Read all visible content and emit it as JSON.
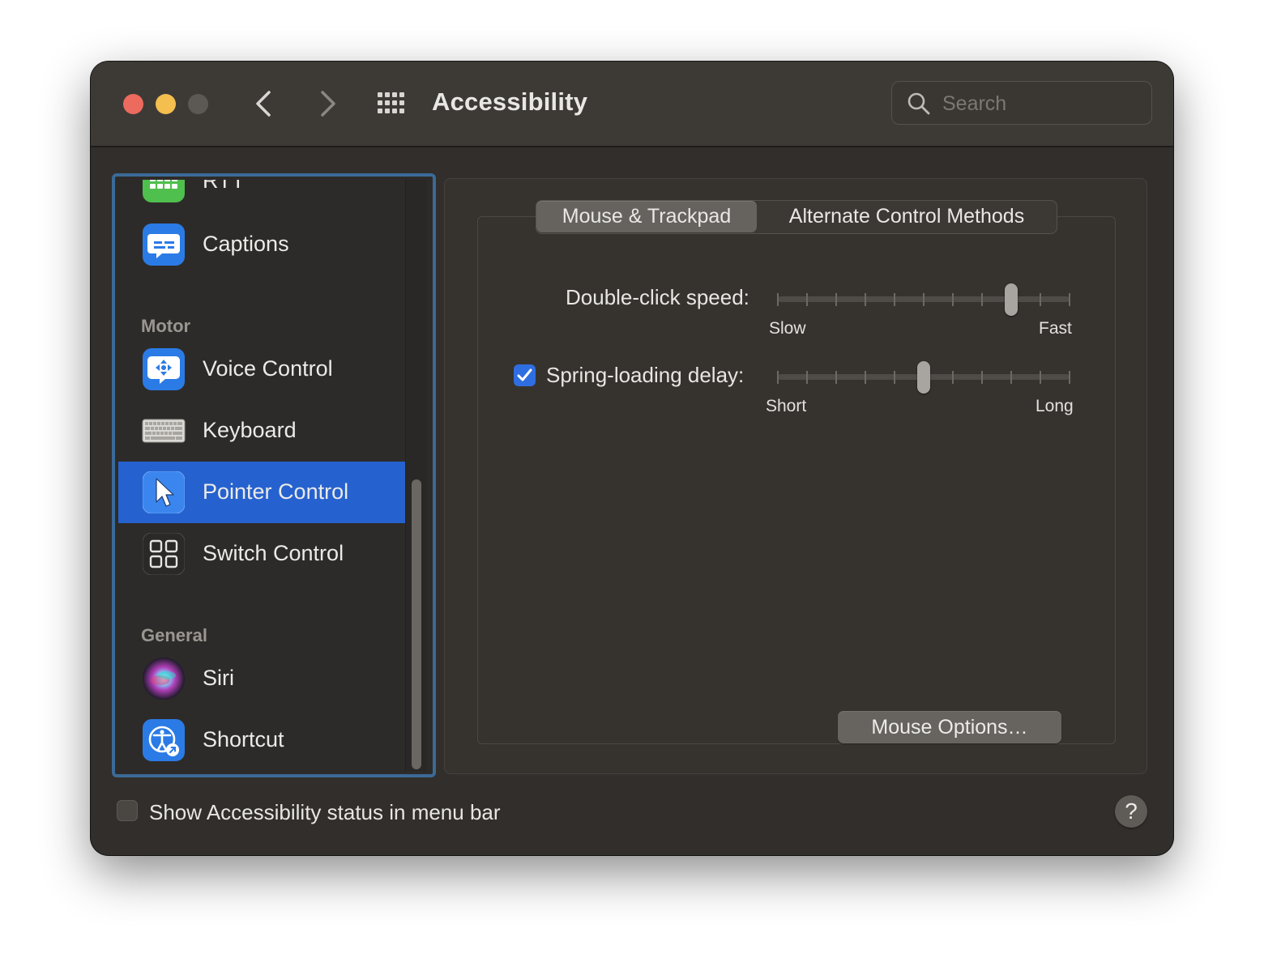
{
  "window": {
    "title": "Accessibility"
  },
  "search": {
    "placeholder": "Search"
  },
  "sidebar": {
    "items": [
      {
        "label": "RTT",
        "icon": "rtt-icon"
      },
      {
        "label": "Captions",
        "icon": "captions-icon"
      },
      {
        "label": "Voice Control",
        "icon": "voice-control-icon"
      },
      {
        "label": "Keyboard",
        "icon": "keyboard-icon"
      },
      {
        "label": "Pointer Control",
        "icon": "pointer-control-icon",
        "selected": true
      },
      {
        "label": "Switch Control",
        "icon": "switch-control-icon"
      },
      {
        "label": "Siri",
        "icon": "siri-icon"
      },
      {
        "label": "Shortcut",
        "icon": "shortcut-icon"
      }
    ],
    "sections": {
      "motor": "Motor",
      "general": "General"
    }
  },
  "tabs": [
    {
      "label": "Mouse & Trackpad",
      "active": true
    },
    {
      "label": "Alternate Control Methods",
      "active": false
    }
  ],
  "settings": {
    "double_click": {
      "label": "Double-click speed:",
      "min_label": "Slow",
      "max_label": "Fast",
      "value_step": 8,
      "steps": 10
    },
    "spring_loading": {
      "label": "Spring-loading delay:",
      "min_label": "Short",
      "max_label": "Long",
      "value_step": 5,
      "steps": 10,
      "enabled": true
    },
    "mouse_options_button": "Mouse Options…"
  },
  "footer": {
    "status_label": "Show Accessibility status in menu bar",
    "status_checked": false,
    "help_label": "?"
  },
  "colors": {
    "selection": "#2562cf",
    "checkbox_accent": "#2f6ee0",
    "sidebar_focus_ring": "#3c6a97"
  }
}
